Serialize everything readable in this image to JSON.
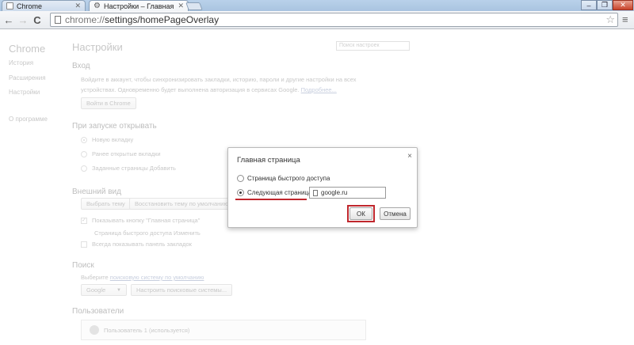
{
  "tabs": [
    {
      "label": "Chrome"
    },
    {
      "label": "Настройки – Главная стр"
    }
  ],
  "window": {
    "minimize": "–",
    "restore": "❐",
    "close": "✕"
  },
  "toolbar": {
    "back": "←",
    "forward": "→",
    "reload": "C",
    "url_scheme": "chrome://",
    "url_path": "settings/homePageOverlay",
    "star": "☆",
    "wrench": "≡"
  },
  "sidebar": {
    "title": "Chrome",
    "items": [
      {
        "label": "История"
      },
      {
        "label": "Расширения"
      },
      {
        "label": "Настройки"
      },
      {
        "label": "О программе"
      }
    ]
  },
  "settings": {
    "title": "Настройки",
    "search_placeholder": "Поиск настроек",
    "signin": {
      "heading": "Вход",
      "line1": "Войдите в аккаунт, чтобы синхронизировать закладки, историю, пароли и другие настройки на всех",
      "line2": "устройствах. Одновременно будет выполнена авторизация в сервисах Google.",
      "more_link": "Подробнее...",
      "button": "Войти в Chrome"
    },
    "startup": {
      "heading": "При запуске открывать",
      "options": [
        {
          "label": "Новую вкладку"
        },
        {
          "label": "Ранее открытые вкладки"
        },
        {
          "label": "Заданные страницы Добавить"
        }
      ]
    },
    "appearance": {
      "heading": "Внешний вид",
      "theme_button": "Выбрать тему",
      "reset_button": "Восстановить тему по умолчанию",
      "show_home": "Показывать кнопку \"Главная страница\"",
      "home_sub": "Страница быстрого доступа Изменить",
      "show_bookmarks": "Всегда показывать панель закладок"
    },
    "search": {
      "heading": "Поиск",
      "line_prefix": "Выберите",
      "line_link": "поисковую систему по умолчанию",
      "engine": "Google",
      "manage_button": "Настроить поисковые системы..."
    },
    "users": {
      "heading": "Пользователи",
      "current": "Пользователь 1 (используется)"
    }
  },
  "dialog": {
    "title": "Главная страница",
    "close": "×",
    "option_fastaccess": "Страница быстрого доступа",
    "option_nextpage": "Следующая страница:",
    "url_value": "google.ru",
    "ok": "ОК",
    "cancel": "Отмена"
  },
  "colors": {
    "highlight": "#c0272d"
  }
}
